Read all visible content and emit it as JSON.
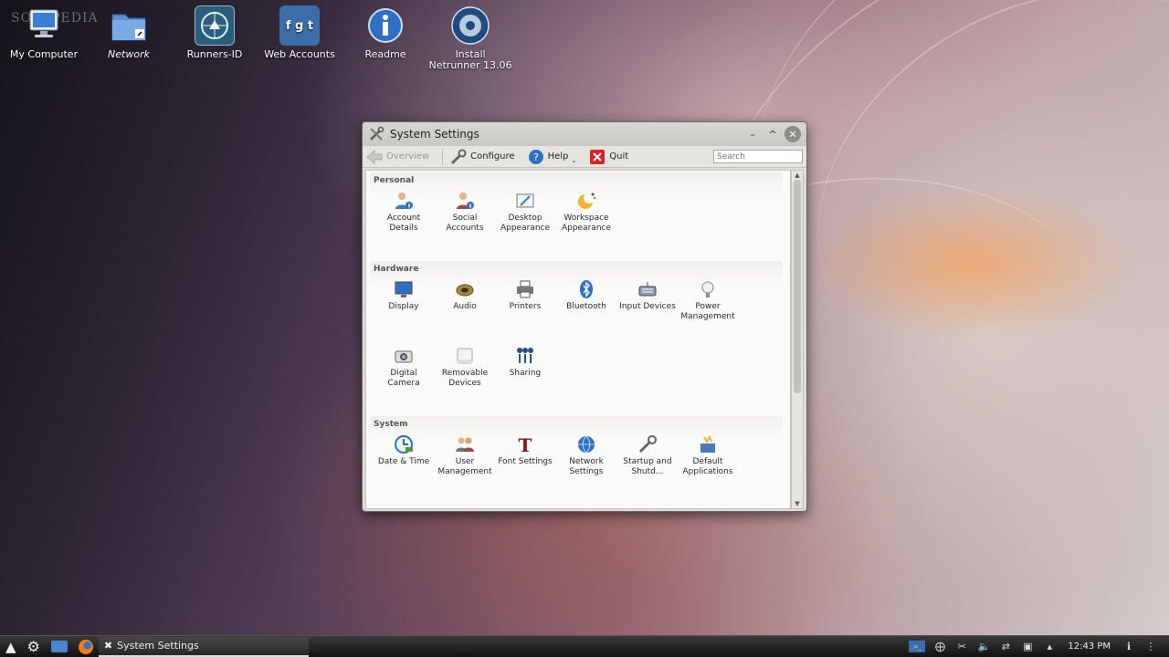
{
  "desktop": {
    "watermark": "SOFTPEDIA",
    "icons": [
      {
        "label": "My Computer",
        "icon": "computer-icon"
      },
      {
        "label": "Network",
        "icon": "network-folder-icon"
      },
      {
        "label": "Runners-ID",
        "icon": "runners-id-icon"
      },
      {
        "label": "Web Accounts",
        "icon": "web-accounts-icon"
      },
      {
        "label": "Readme",
        "icon": "info-icon"
      },
      {
        "label": "Install Netrunner 13.06",
        "icon": "install-disc-icon"
      }
    ]
  },
  "window": {
    "title": "System Settings",
    "toolbar": {
      "overview": "Overview",
      "configure": "Configure",
      "help": "Help",
      "quit": "Quit",
      "search_placeholder": "Search"
    },
    "categories": [
      {
        "title": "Personal",
        "modules": [
          {
            "label": "Account Details",
            "icon": "account-details-icon"
          },
          {
            "label": "Social Accounts",
            "icon": "social-accounts-icon"
          },
          {
            "label": "Desktop Appearance",
            "icon": "desktop-appearance-icon"
          },
          {
            "label": "Workspace Appearance",
            "icon": "workspace-appearance-icon"
          }
        ]
      },
      {
        "title": "Hardware",
        "modules": [
          {
            "label": "Display",
            "icon": "display-icon"
          },
          {
            "label": "Audio",
            "icon": "audio-icon"
          },
          {
            "label": "Printers",
            "icon": "printer-icon"
          },
          {
            "label": "Bluetooth",
            "icon": "bluetooth-icon"
          },
          {
            "label": "Input Devices",
            "icon": "input-devices-icon"
          },
          {
            "label": "Power Management",
            "icon": "power-icon"
          },
          {
            "label": "Digital Camera",
            "icon": "camera-icon"
          },
          {
            "label": "Removable Devices",
            "icon": "removable-devices-icon"
          },
          {
            "label": "Sharing",
            "icon": "sharing-icon"
          }
        ]
      },
      {
        "title": "System",
        "modules": [
          {
            "label": "Date & Time",
            "icon": "clock-icon"
          },
          {
            "label": "User Management",
            "icon": "users-icon"
          },
          {
            "label": "Font Settings",
            "icon": "font-icon"
          },
          {
            "label": "Network Settings",
            "icon": "globe-icon"
          },
          {
            "label": "Startup and Shutd...",
            "icon": "startup-icon"
          },
          {
            "label": "Default Applications",
            "icon": "default-apps-icon"
          }
        ]
      }
    ]
  },
  "taskbar": {
    "task": "System Settings",
    "clock": "12:43 PM"
  },
  "colors": {
    "window_bg": "#dedcd8",
    "content_bg": "#fbfbfa",
    "taskbar_bg": "#121212",
    "accent_blue": "#2f6fc4"
  }
}
